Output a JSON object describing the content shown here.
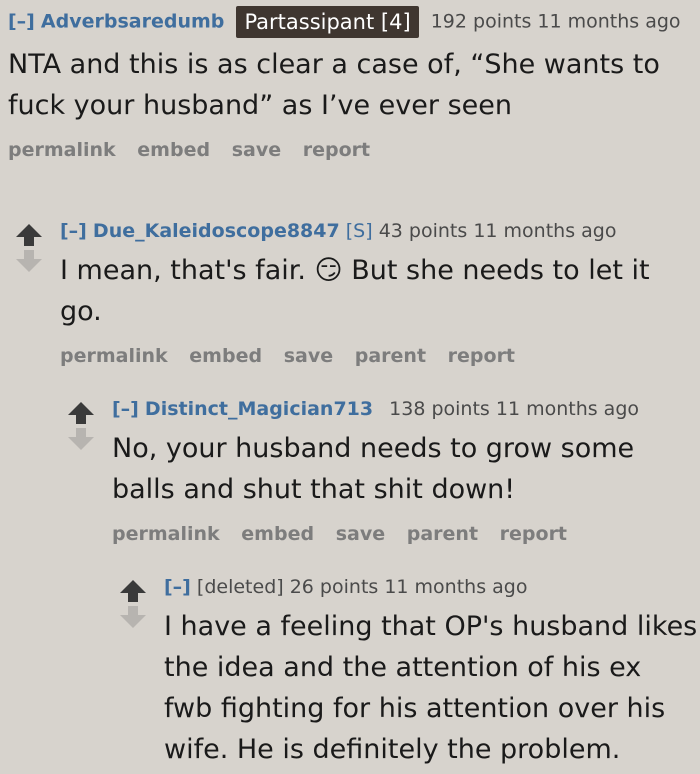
{
  "comments": [
    {
      "toggle": "[–]",
      "author": "Adverbsaredumb",
      "flair": "Partassipant [4]",
      "meta": "192 points 11 months ago",
      "body": "NTA and this is as clear a case of, “She wants to fuck your husband” as I’ve ever seen",
      "buttons": [
        "permalink",
        "embed",
        "save",
        "report"
      ]
    },
    {
      "toggle": "[–]",
      "author": "Due_Kaleidoscope8847",
      "submitter": "[S]",
      "meta": "43 points 11 months ago",
      "body": "I mean, that's fair. 😏 But she needs to let it go.",
      "buttons": [
        "permalink",
        "embed",
        "save",
        "parent",
        "report"
      ]
    },
    {
      "toggle": "[–]",
      "author": "Distinct_Magician713",
      "meta": "138 points 11 months ago",
      "body": "No, your husband needs to grow some balls and shut that shit down!",
      "buttons": [
        "permalink",
        "embed",
        "save",
        "parent",
        "report"
      ]
    },
    {
      "toggle": "[–]",
      "author": "[deleted]",
      "meta": "26 points 11 months ago",
      "body": "I have a feeling that OP's husband likes the idea and the attention of his ex fwb fighting for his attention over his wife. He is definitely the problem.",
      "buttons": []
    }
  ],
  "colors": {
    "background": "#d7d3cd",
    "link": "#3f6e9e",
    "flair_bg": "#3f3630",
    "muted": "#7d7d7d"
  },
  "icons": {
    "upvote": "upvote-arrow-icon",
    "downvote": "downvote-arrow-icon"
  }
}
